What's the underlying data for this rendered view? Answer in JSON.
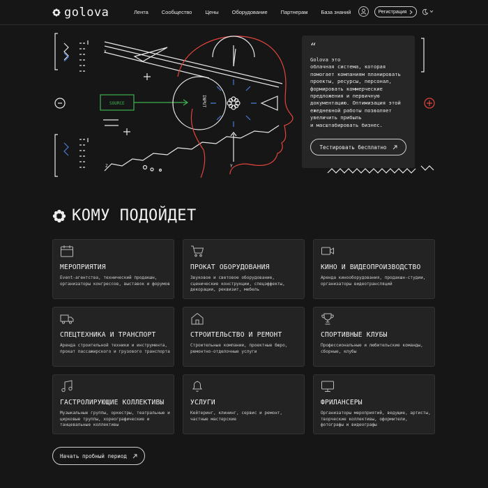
{
  "brand": {
    "name": "golova"
  },
  "nav": {
    "items": [
      "Лента",
      "Сообщество",
      "Цены",
      "Оборудование",
      "Партнерам",
      "База знаний"
    ]
  },
  "header": {
    "register_label": "Регистрация"
  },
  "hero": {
    "source_label": "SOURCE",
    "input_label": "INPUT",
    "x_label": "X",
    "y_label": "Y",
    "z_label": "Z",
    "quote_mark": "“",
    "text": "Golova это\nоблачная система, которая\nпомогает компаниям планировать\nпроекты, ресурсы, персонал,\nформировать коммерческие\nпредложения и первичную\nдокументацию. Оптимизация этой\nежедневной работы позволяет\nувеличить прибыль\nи масштабировать бизнес.",
    "cta_label": "Тестировать бесплатно"
  },
  "who": {
    "title": "КОМУ ПОДОЙДЕТ",
    "tiles": [
      {
        "icon": "calendar-icon",
        "title": "МЕРОПРИЯТИЯ",
        "desc": "Event-агентства, технический продакшн, организаторы конгрессов, выставок и форумов"
      },
      {
        "icon": "cart-icon",
        "title": "ПРОКАТ ОБОРУДОВАНИЯ",
        "desc": "Звуковое и световое оборудование, сценические конструкции, спецэффекты, декорации, реквизит, мебель"
      },
      {
        "icon": "video-camera-icon",
        "title": "КИНО И ВИДЕОПРОИЗВОДСТВО",
        "desc": "Аренда кинооборудования, продакшн-студии, организаторы видеотрансляций"
      },
      {
        "icon": "truck-icon",
        "title": "СПЕЦТЕХНИКА И ТРАНСПОРТ",
        "desc": "Аренда строительной техники и инструмента, прокат пассажирского и грузового транспорта"
      },
      {
        "icon": "house-icon",
        "title": "СТРОИТЕЛЬСТВО И РЕМОНТ",
        "desc": "Строительные компании, проектные бюро, ремонтно-отделочные услуги"
      },
      {
        "icon": "trophy-icon",
        "title": "СПОРТИВНЫЕ КЛУБЫ",
        "desc": "Профессиональные и любительские команды, сборные, клубы"
      },
      {
        "icon": "music-note-icon",
        "title": "ГАСТРОЛИРУЮЩИЕ КОЛЛЕКТИВЫ",
        "desc": "Музыкальные группы, оркестры, театральные и цирковые труппы, хореографические и танцевальные коллективы"
      },
      {
        "icon": "bell-icon",
        "title": "УСЛУГИ",
        "desc": "Кейтеринг, клининг, сервис и ремонт, частные мастерские"
      },
      {
        "icon": "monitor-icon",
        "title": "ФРИЛАНСЕРЫ",
        "desc": "Организаторы мероприятий, ведущие, артисты, творческие коллективы, оформители, фотографы и видеографы"
      }
    ]
  },
  "footer_cta": {
    "label": "Начать пробный период"
  },
  "colors": {
    "background": "#161616",
    "accent_red": "#e2453c",
    "accent_green": "#3fb34f",
    "accent_blue": "#4b7bd6"
  }
}
